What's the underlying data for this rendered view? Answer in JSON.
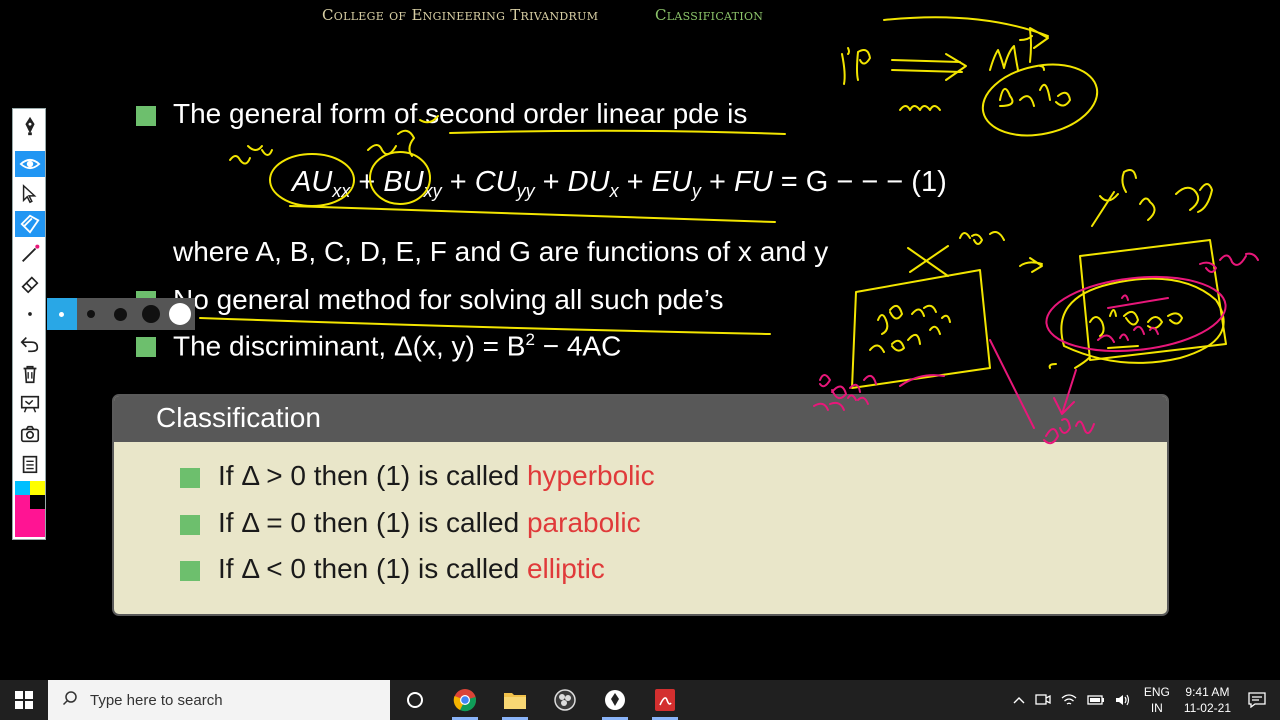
{
  "header": {
    "college": "College of Engineering Trivandrum",
    "section": "Classification"
  },
  "bullets": {
    "b1": "The general form of second order linear pde is",
    "where": "where A, B, C, D, E, F and G are functions of x and y",
    "b2": "No general method for solving all such pde’s",
    "b3_prefix": "The discriminant, Δ(x, y) = B",
    "b3_sup": "2",
    "b3_suffix": " − 4AC"
  },
  "equation": {
    "tail": " = G − − − (1)"
  },
  "classification": {
    "title": "Classification",
    "items": [
      {
        "prefix": "If Δ > 0 then (1) is called ",
        "keyword": "hyperbolic"
      },
      {
        "prefix": "If Δ = 0 then (1) is called ",
        "keyword": "parabolic"
      },
      {
        "prefix": "If Δ < 0 then (1) is called ",
        "keyword": "elliptic"
      }
    ]
  },
  "colors": {
    "bullet": "#6dbf6d",
    "keyword": "#e03a3a",
    "ink_yellow": "#f2e500",
    "ink_pink": "#e8177a"
  },
  "toolbar": {
    "icons": [
      "pen-icon",
      "eye-icon",
      "cursor-icon",
      "tag-icon",
      "line-icon",
      "eraser-icon",
      "dot-icon",
      "undo-icon",
      "trash-icon",
      "whiteboard-icon",
      "camera-icon",
      "notes-icon"
    ],
    "swatches": [
      "#00bfff",
      "#ffff00",
      "#ff1493",
      "#000000"
    ]
  },
  "taskbar": {
    "search_placeholder": "Type here to search",
    "lang_top": "ENG",
    "lang_bottom": "IN",
    "time": "9:41 AM",
    "date": "11-02-21"
  }
}
